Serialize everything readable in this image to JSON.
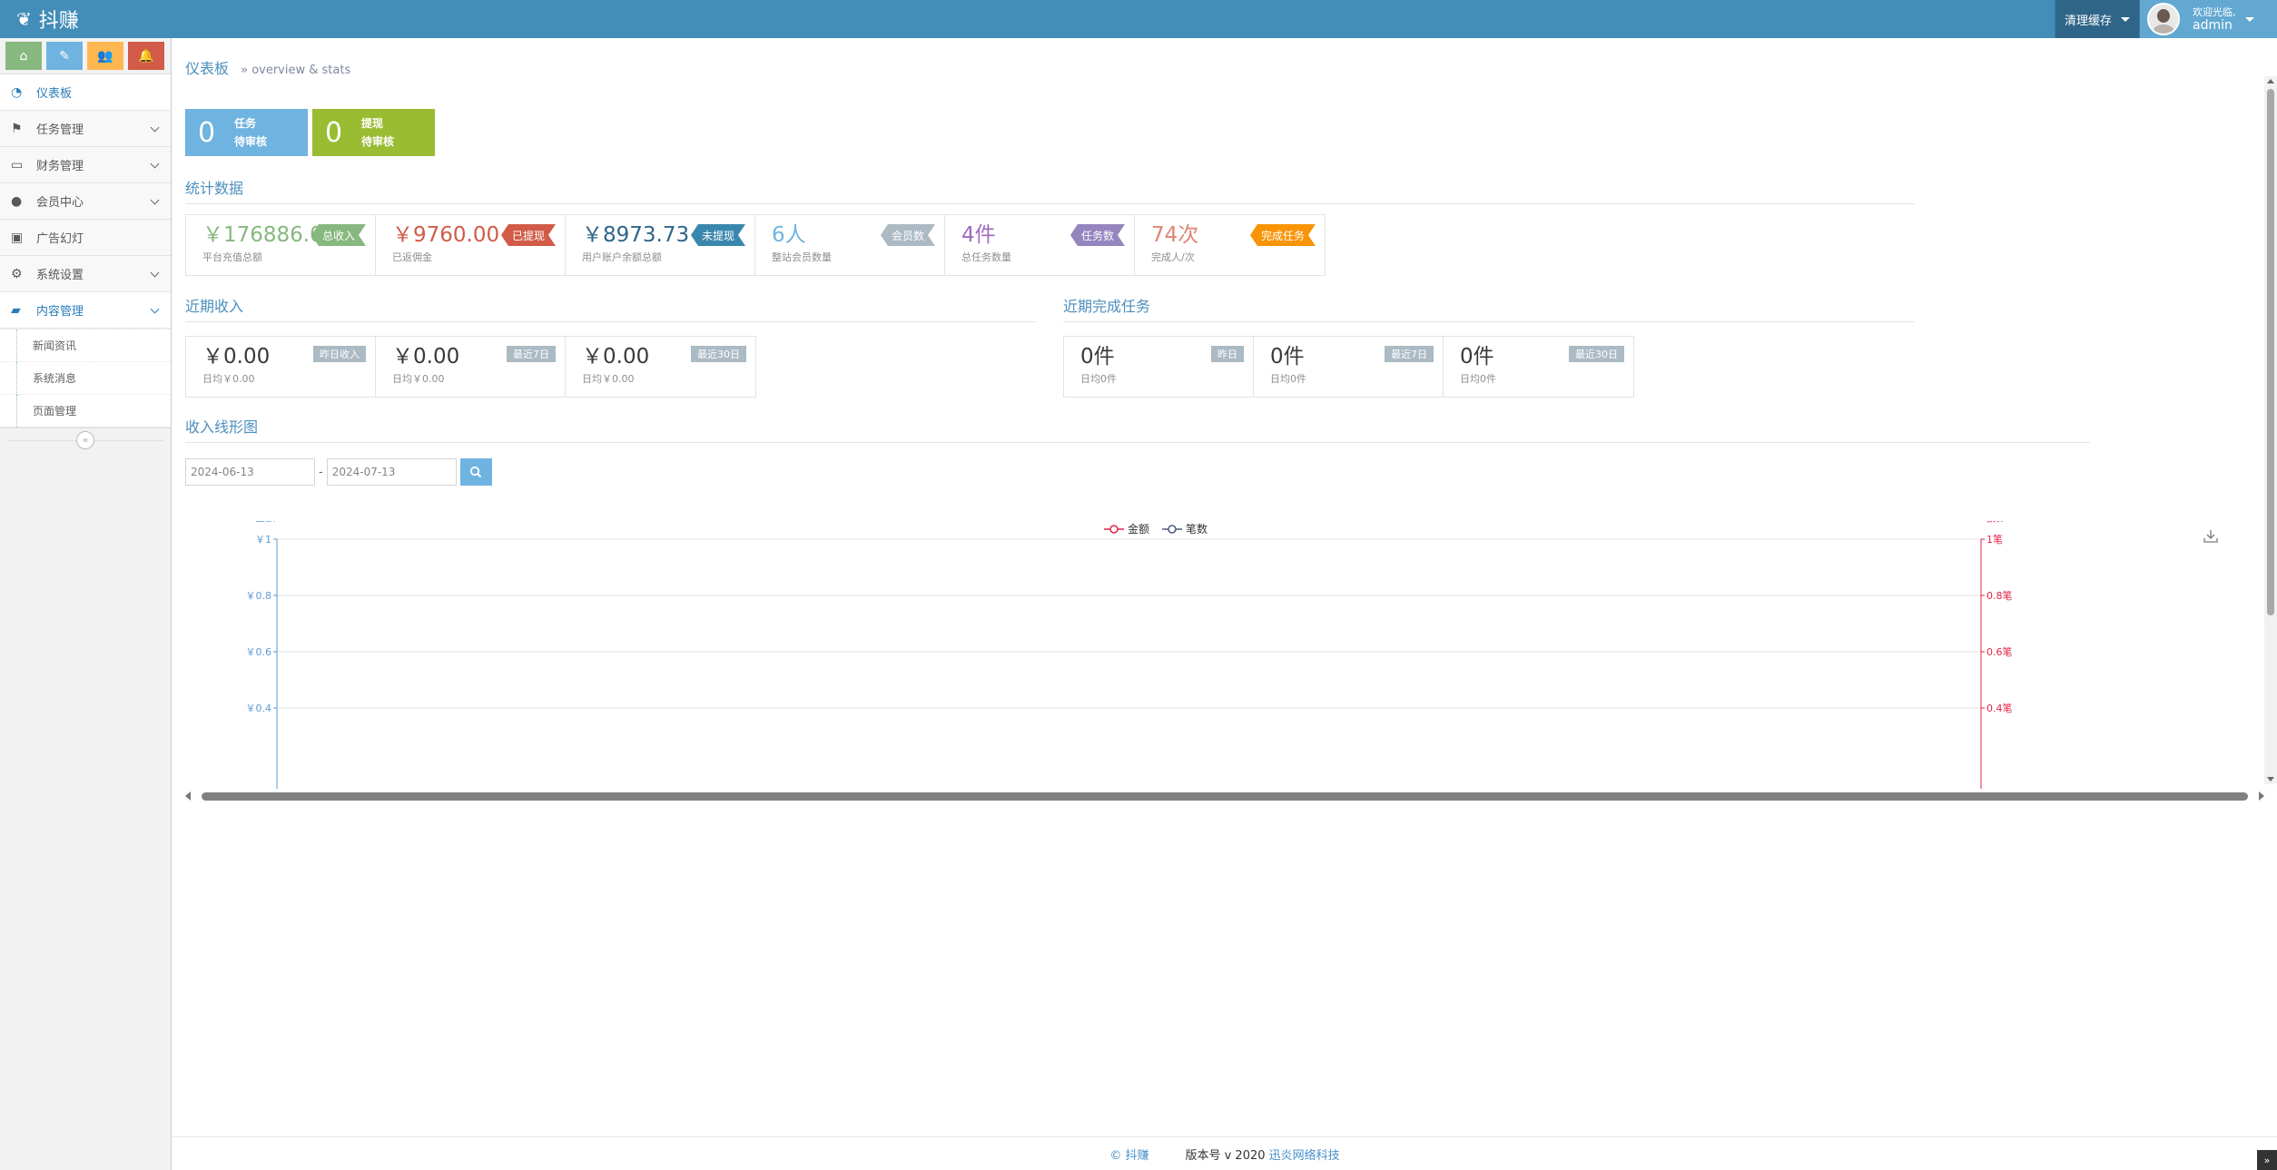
{
  "navbar": {
    "brand": "抖赚",
    "cache_label": "清理缓存",
    "welcome": "欢迎光临,",
    "username": "admin"
  },
  "sidebar": {
    "items": [
      {
        "label": "仪表板",
        "icon": "dashboard-icon"
      },
      {
        "label": "任务管理",
        "icon": "flag-icon"
      },
      {
        "label": "财务管理",
        "icon": "inbox-icon"
      },
      {
        "label": "会员中心",
        "icon": "user-icon"
      },
      {
        "label": "广告幻灯",
        "icon": "picture-icon"
      },
      {
        "label": "系统设置",
        "icon": "gear-icon"
      },
      {
        "label": "内容管理",
        "icon": "book-icon"
      }
    ],
    "sub_items": [
      {
        "label": "新闻资讯"
      },
      {
        "label": "系统消息"
      },
      {
        "label": "页面管理"
      }
    ]
  },
  "breadcrumb": {
    "title": "仪表板",
    "subtitle": "» overview & stats"
  },
  "pending": [
    {
      "num": "0",
      "line1": "任务",
      "line2": "待审核",
      "color": "#6fb3e0"
    },
    {
      "num": "0",
      "line1": "提现",
      "line2": "待审核",
      "color": "#9abc32"
    }
  ],
  "sections": {
    "stats": "统计数据",
    "income": "近期收入",
    "tasks": "近期完成任务",
    "chart": "收入线形图"
  },
  "stats": [
    {
      "value": "￥176886.00",
      "desc": "平台充值总额",
      "tag": "总收入",
      "value_color": "#87b87f",
      "tag_color": "#87b87f"
    },
    {
      "value": "￥9760.00",
      "desc": "已返佣金",
      "tag": "已提现",
      "value_color": "#d15b47",
      "tag_color": "#d15b47"
    },
    {
      "value": "￥8973.73",
      "desc": "用户账户余额总额",
      "tag": "未提现",
      "value_color": "#2e6589",
      "tag_color": "#3a87ad"
    },
    {
      "value": "6人",
      "desc": "整站会员数量",
      "tag": "会员数",
      "value_color": "#6fb3e0",
      "tag_color": "#abbac3"
    },
    {
      "value": "4件",
      "desc": "总任务数量",
      "tag": "任务数",
      "value_color": "#a069c3",
      "tag_color": "#9585bf"
    },
    {
      "value": "74次",
      "desc": "完成人/次",
      "tag": "完成任务",
      "value_color": "#e08374",
      "tag_color": "#f89406"
    }
  ],
  "income": [
    {
      "value": "￥0.00",
      "desc": "日均￥0.00",
      "tag": "昨日收入"
    },
    {
      "value": "￥0.00",
      "desc": "日均￥0.00",
      "tag": "最近7日"
    },
    {
      "value": "￥0.00",
      "desc": "日均￥0.00",
      "tag": "最近30日"
    }
  ],
  "tasks": [
    {
      "value": "0件",
      "desc": "日均0件",
      "tag": "昨日"
    },
    {
      "value": "0件",
      "desc": "日均0件",
      "tag": "最近7日"
    },
    {
      "value": "0件",
      "desc": "日均0件",
      "tag": "最近30日"
    }
  ],
  "filter": {
    "start_date": "2024-06-13",
    "end_date": "2024-07-13",
    "separator": "-"
  },
  "chart_data": {
    "type": "line",
    "series": [
      {
        "name": "金额",
        "color": "#e0244a",
        "values": []
      },
      {
        "name": "笔数",
        "color": "#4a5b78",
        "values": []
      }
    ],
    "y_left": {
      "label": "金额",
      "ticks": [
        "￥1",
        "￥0.8",
        "￥0.6",
        "￥0.4"
      ],
      "tick_values": [
        1,
        0.8,
        0.6,
        0.4
      ],
      "color": "#5b9bd5"
    },
    "y_right": {
      "label": "笔数",
      "ticks": [
        "1笔",
        "0.8笔",
        "0.6笔",
        "0.4笔"
      ],
      "tick_values": [
        1,
        0.8,
        0.6,
        0.4
      ],
      "color": "#e0244a"
    },
    "ylim": [
      0,
      1
    ],
    "grid": true,
    "legend": "top-center"
  },
  "footer": {
    "brand": "© 抖赚",
    "version": "版本号 v 2020",
    "company": "迅炎网络科技"
  }
}
